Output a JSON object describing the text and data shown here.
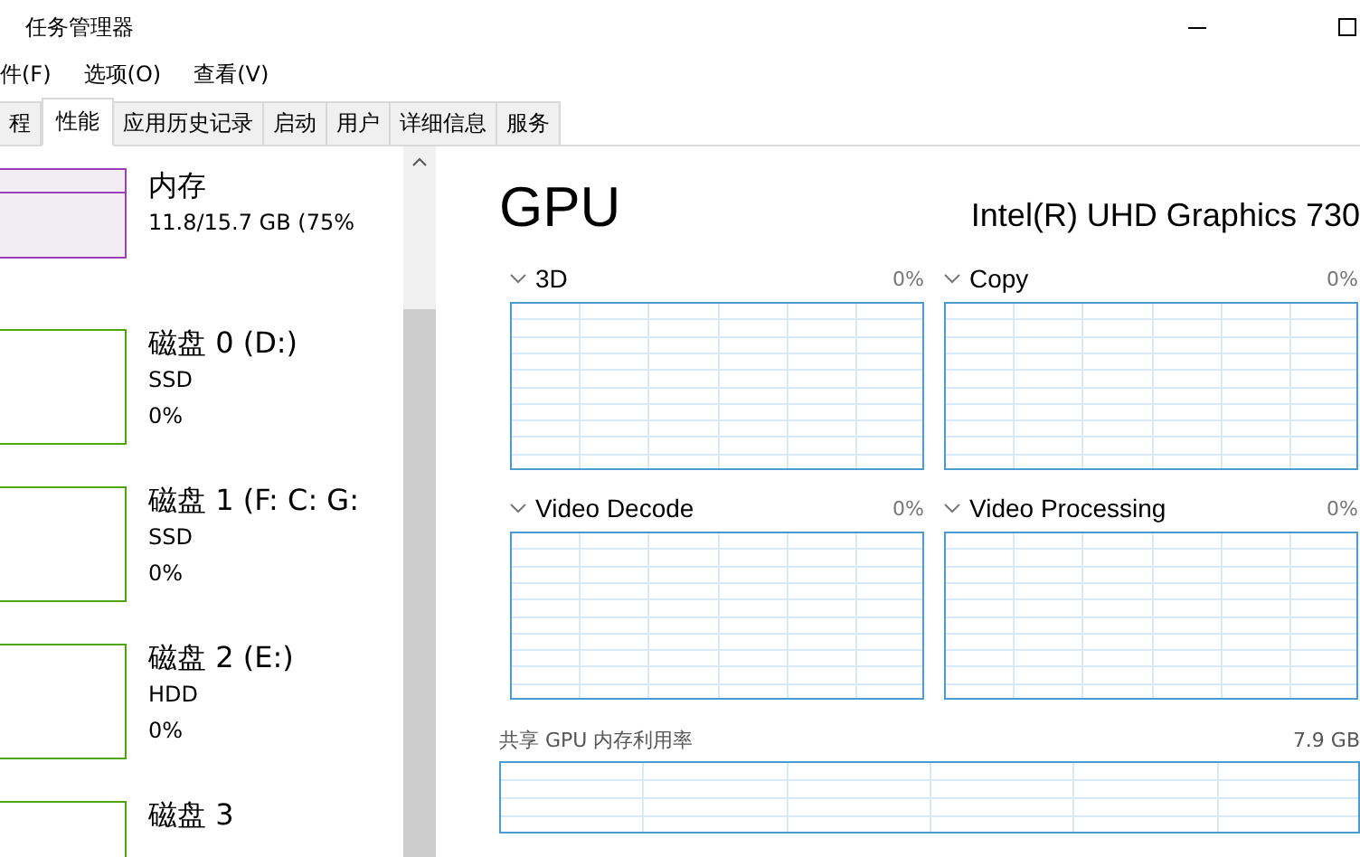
{
  "window": {
    "title": "任务管理器"
  },
  "menu": [
    "件(F)",
    "选项(O)",
    "查看(V)"
  ],
  "tabs": [
    {
      "label": "程",
      "selected": false
    },
    {
      "label": "性能",
      "selected": true
    },
    {
      "label": "应用历史记录",
      "selected": false
    },
    {
      "label": "启动",
      "selected": false
    },
    {
      "label": "用户",
      "selected": false
    },
    {
      "label": "详细信息",
      "selected": false
    },
    {
      "label": "服务",
      "selected": false
    }
  ],
  "sidebar": {
    "items": [
      {
        "kind": "memory",
        "name": "内存",
        "lines": [
          "11.8/15.7 GB (75%"
        ],
        "color": "#9b3fbd"
      },
      {
        "kind": "disk",
        "name": "磁盘 0 (D:)",
        "lines": [
          "SSD",
          "0%"
        ],
        "color": "#4da60c"
      },
      {
        "kind": "disk",
        "name": "磁盘 1 (F: C: G:",
        "lines": [
          "SSD",
          "0%"
        ],
        "color": "#4da60c"
      },
      {
        "kind": "disk",
        "name": "磁盘 2 (E:)",
        "lines": [
          "HDD",
          "0%"
        ],
        "color": "#4da60c"
      },
      {
        "kind": "disk",
        "name": "磁盘 3",
        "color": "#4da60c"
      }
    ]
  },
  "detail": {
    "title": "GPU",
    "device": "Intel(R) UHD Graphics 730",
    "engines": [
      {
        "name": "3D",
        "value": "0%"
      },
      {
        "name": "Copy",
        "value": "0%"
      },
      {
        "name": "Video Decode",
        "value": "0%"
      },
      {
        "name": "Video Processing",
        "value": "0%"
      }
    ],
    "shared_memory": {
      "label": "共享 GPU 内存利用率",
      "value": "7.9 GB"
    }
  }
}
